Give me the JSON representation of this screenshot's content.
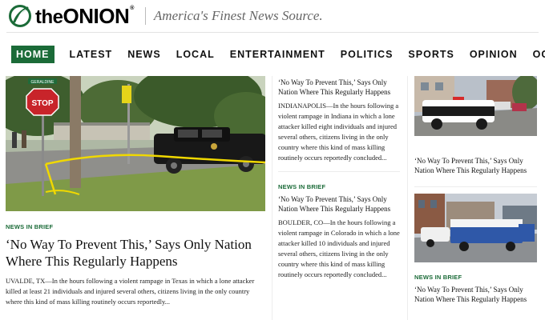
{
  "header": {
    "logo_text_the": "the",
    "logo_text_onion": "ONION",
    "logo_registered": "®",
    "tagline": "America's Finest News Source."
  },
  "nav": {
    "items": [
      {
        "label": "HOME",
        "active": true
      },
      {
        "label": "LATEST"
      },
      {
        "label": "NEWS"
      },
      {
        "label": "LOCAL"
      },
      {
        "label": "ENTERTAINMENT"
      },
      {
        "label": "POLITICS"
      },
      {
        "label": "SPORTS"
      },
      {
        "label": "OPINION"
      },
      {
        "label": "OGN"
      }
    ]
  },
  "main_story": {
    "kicker": "NEWS IN BRIEF",
    "headline": "‘No Way To Prevent This,’ Says Only Nation Where This Regularly Happens",
    "excerpt": "UVALDE, TX—In the hours following a violent rampage in Texas in which a lone attacker killed at least 21 individuals and injured several others, citizens living in the only country where this kind of mass killing routinely occurs reportedly...",
    "image_sign_text": "STOP",
    "image_street_sign": "GERALDINE"
  },
  "mid_column": {
    "stories": [
      {
        "headline": "‘No Way To Prevent This,’ Says Only Nation Where This Regularly Happens",
        "excerpt": "INDIANAPOLIS—In the hours following a violent rampage in Indiana in which a lone attacker killed eight individuals and injured several others, citizens living in the only country where this kind of mass killing routinely occurs reportedly concluded..."
      },
      {
        "kicker": "NEWS IN BRIEF",
        "headline": "‘No Way To Prevent This,’ Says Only Nation Where This Regularly Happens",
        "excerpt": "BOULDER, CO—In the hours following a violent rampage in Colorado in which a lone attacker killed 10 individuals and injured several others, citizens living in the only country where this kind of mass killing routinely occurs reportedly concluded..."
      }
    ]
  },
  "right_column": {
    "stories": [
      {
        "headline": "‘No Way To Prevent This,’ Says Only Nation Where This Regularly Happens"
      },
      {
        "kicker": "NEWS IN BRIEF",
        "headline": "‘No Way To Prevent This,’ Says Only Nation Where This Regularly Happens"
      }
    ]
  },
  "colors": {
    "brand_green": "#1b6b38",
    "tagline_gray": "#666666"
  }
}
